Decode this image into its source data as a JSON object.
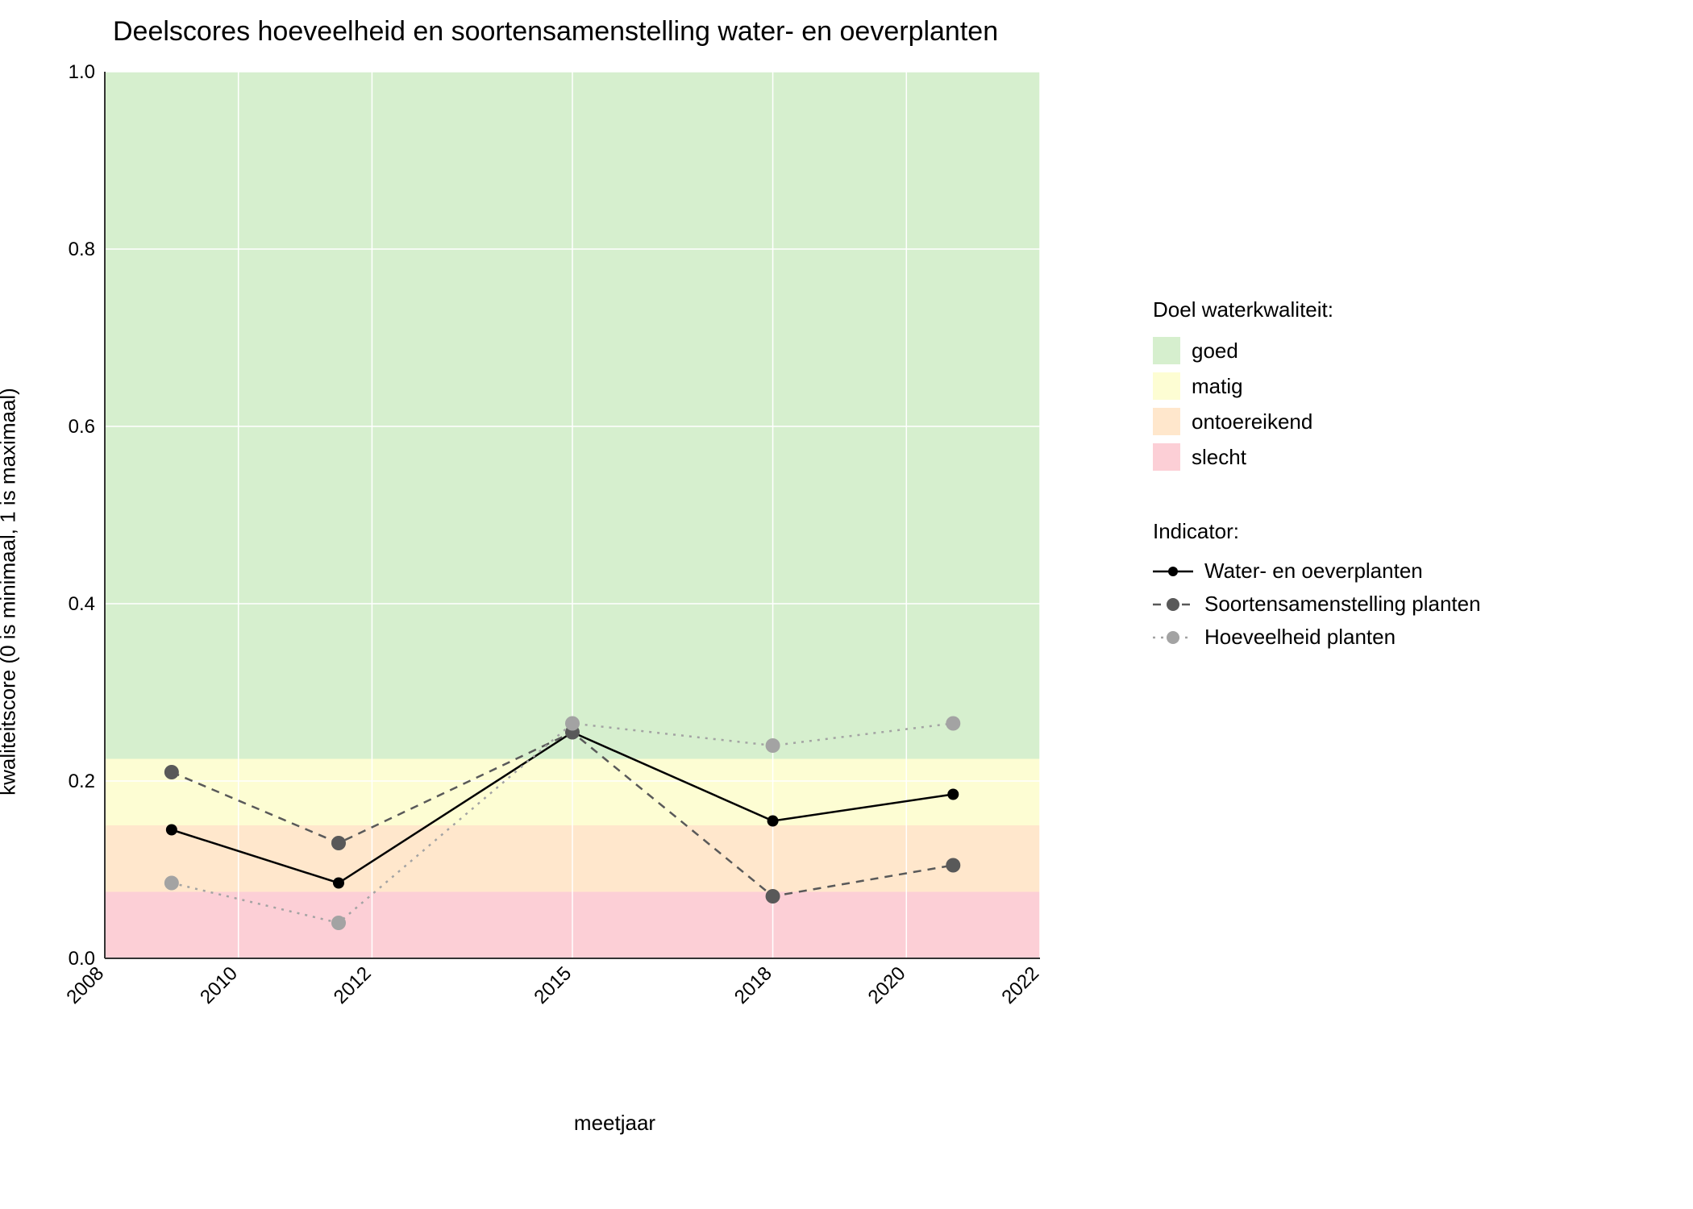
{
  "chart_data": {
    "type": "line",
    "title": "Deelscores hoeveelheid en soortensamenstelling water- en oeverplanten",
    "xlabel": "meetjaar",
    "ylabel": "kwaliteitscore (0 is minimaal, 1 is maximaal)",
    "xlim": [
      2008,
      2022
    ],
    "ylim": [
      0,
      1.0
    ],
    "xticks": [
      2008,
      2010,
      2012,
      2015,
      2018,
      2020,
      2022
    ],
    "yticks": [
      0.0,
      0.2,
      0.4,
      0.6,
      0.8,
      1.0
    ],
    "x": [
      2009,
      2011.5,
      2015,
      2018,
      2020.7
    ],
    "bands": {
      "title": "Doel waterkwaliteit:",
      "levels": [
        {
          "name": "goed",
          "from": 0.225,
          "to": 1.0,
          "color": "#d6efce"
        },
        {
          "name": "matig",
          "from": 0.15,
          "to": 0.225,
          "color": "#fdfdd3"
        },
        {
          "name": "ontoereikend",
          "from": 0.075,
          "to": 0.15,
          "color": "#ffe7cc"
        },
        {
          "name": "slecht",
          "from": 0.0,
          "to": 0.075,
          "color": "#fccfd6"
        }
      ]
    },
    "series": [
      {
        "name": "Water- en oeverplanten",
        "color": "#000000",
        "dash": "solid",
        "values": [
          0.145,
          0.085,
          0.255,
          0.155,
          0.185
        ]
      },
      {
        "name": "Soortensamenstelling planten",
        "color": "#595959",
        "dash": "dashed",
        "values": [
          0.21,
          0.13,
          0.255,
          0.07,
          0.105
        ]
      },
      {
        "name": "Hoeveelheid planten",
        "color": "#a3a3a3",
        "dash": "dotted",
        "values": [
          0.085,
          0.04,
          0.265,
          0.24,
          0.265
        ]
      }
    ]
  },
  "legend": {
    "indicator_title": "Indicator:"
  }
}
